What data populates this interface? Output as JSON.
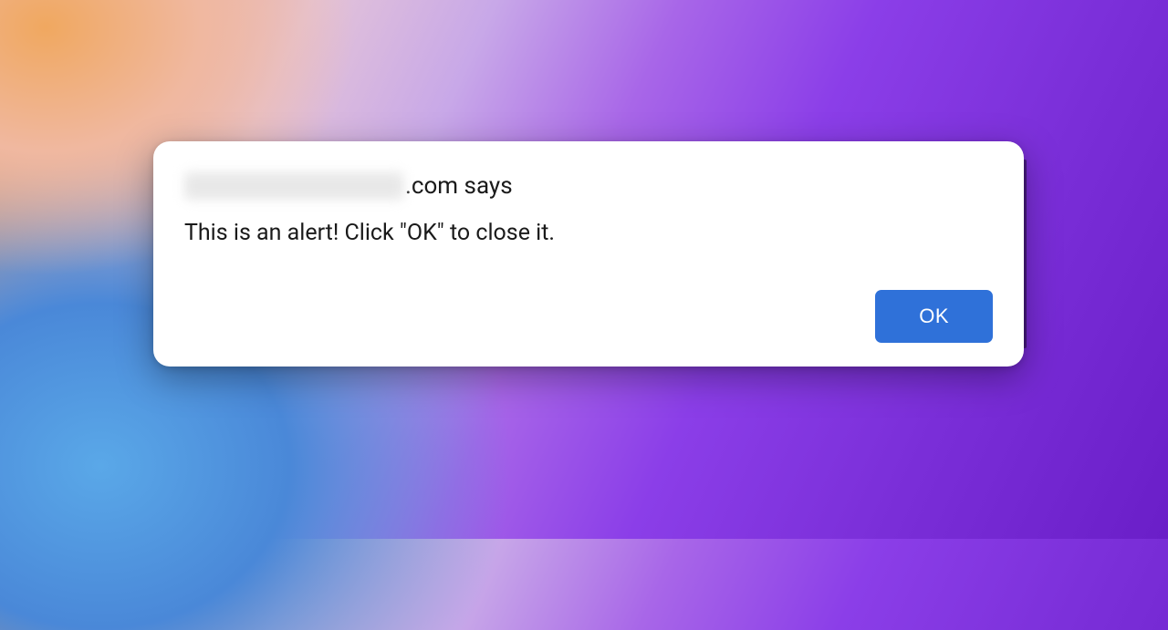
{
  "alert": {
    "origin_suffix": ".com says",
    "message": "This is an alert! Click \"OK\" to close it.",
    "ok_label": "OK"
  }
}
